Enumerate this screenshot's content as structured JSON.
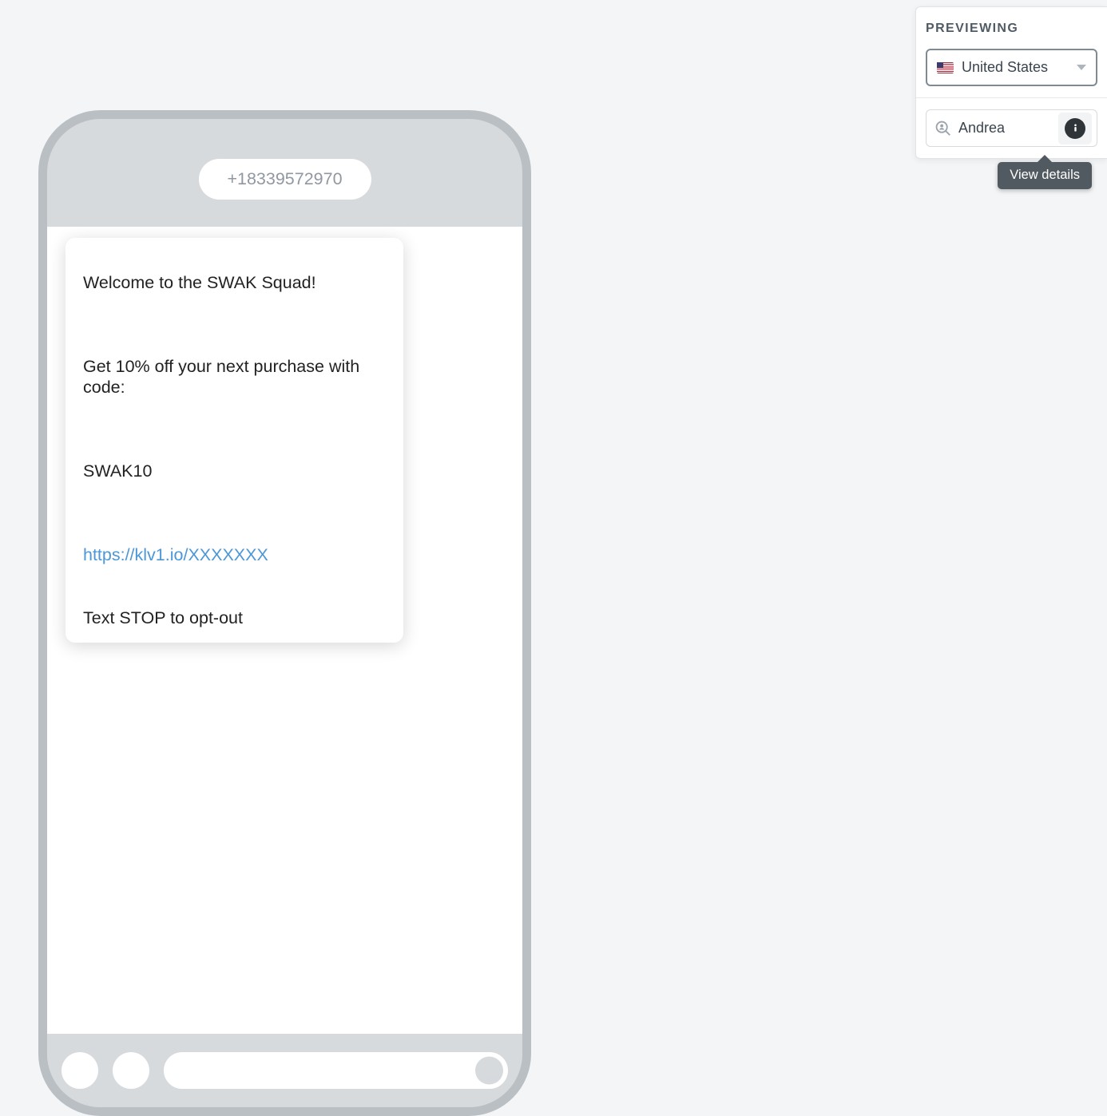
{
  "preview": {
    "title": "PREVIEWING",
    "country_selected": "United States",
    "contact_name": "Andrea",
    "tooltip_text": "View details"
  },
  "phone": {
    "sender_number": "+18339572970",
    "message": {
      "line1": "Welcome to the SWAK Squad!",
      "line2": "Get 10% off your next purchase with code:",
      "code": "SWAK10",
      "link": "https://klv1.io/XXXXXXX",
      "optout": "Text STOP to opt-out"
    }
  }
}
